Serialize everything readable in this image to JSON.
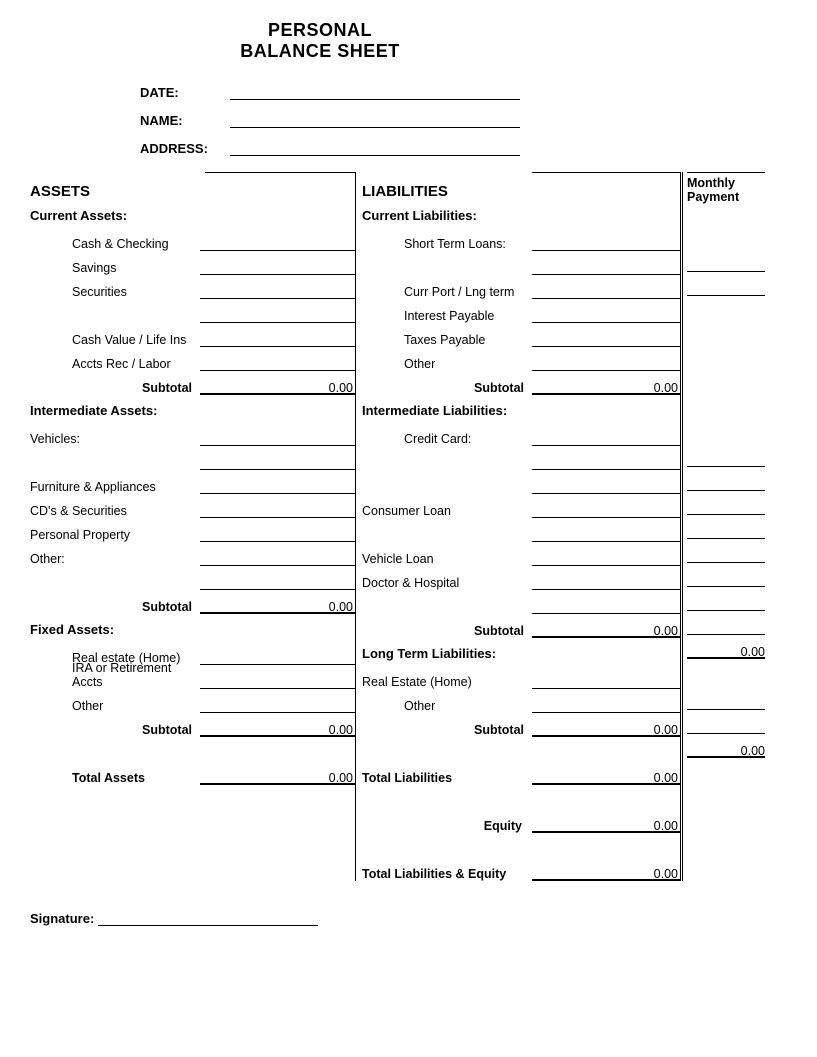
{
  "title1": "PERSONAL",
  "title2": "BALANCE SHEET",
  "header": {
    "date": "DATE:",
    "name": "NAME:",
    "address": "ADDRESS:"
  },
  "assets": {
    "heading": "ASSETS",
    "current": {
      "head": "Current Assets:",
      "items": [
        "Cash & Checking",
        "Savings",
        "Securities",
        "",
        "Cash Value / Life Ins",
        "Accts Rec / Labor"
      ],
      "subtotal_label": "Subtotal",
      "subtotal": "0.00"
    },
    "intermediate": {
      "head": "Intermediate Assets:",
      "vehicles": "Vehicles:",
      "items": [
        "Furniture & Appliances",
        "CD's & Securities",
        "Personal Property",
        "Other:"
      ],
      "subtotal_label": "Subtotal",
      "subtotal": "0.00"
    },
    "fixed": {
      "head": "Fixed Assets:",
      "items": [
        "Real estate (Home)",
        "IRA or Retirement Accts",
        "Other"
      ],
      "subtotal_label": "Subtotal",
      "subtotal": "0.00"
    },
    "total_label": "Total Assets",
    "total": "0.00"
  },
  "liab": {
    "heading": "LIABILITIES",
    "mp_heading": "Monthly Payment",
    "current": {
      "head": "Current Liabilities:",
      "items": [
        "Short Term Loans:",
        "",
        "Curr Port / Lng term",
        "Interest Payable",
        "Taxes Payable",
        "Other"
      ],
      "subtotal_label": "Subtotal",
      "subtotal": "0.00"
    },
    "intermediate": {
      "head": "Intermediate Liabilities:",
      "credit": "Credit  Card:",
      "consumer": "Consumer Loan",
      "vehicle": "Vehicle Loan",
      "doctor": "Doctor & Hospital",
      "subtotal_label": "Subtotal",
      "subtotal": "0.00",
      "mp_subtotal": "0.00"
    },
    "longterm": {
      "head": "Long Term Liabilities:",
      "items": [
        "Real Estate (Home)",
        "Other"
      ],
      "subtotal_label": "Subtotal",
      "subtotal": "0.00",
      "mp_subtotal": "0.00"
    },
    "total_label": "Total Liabilities",
    "total": "0.00",
    "equity_label": "Equity",
    "equity": "0.00",
    "tle_label": "Total Liabilities & Equity",
    "tle": "0.00"
  },
  "signature_label": "Signature:"
}
